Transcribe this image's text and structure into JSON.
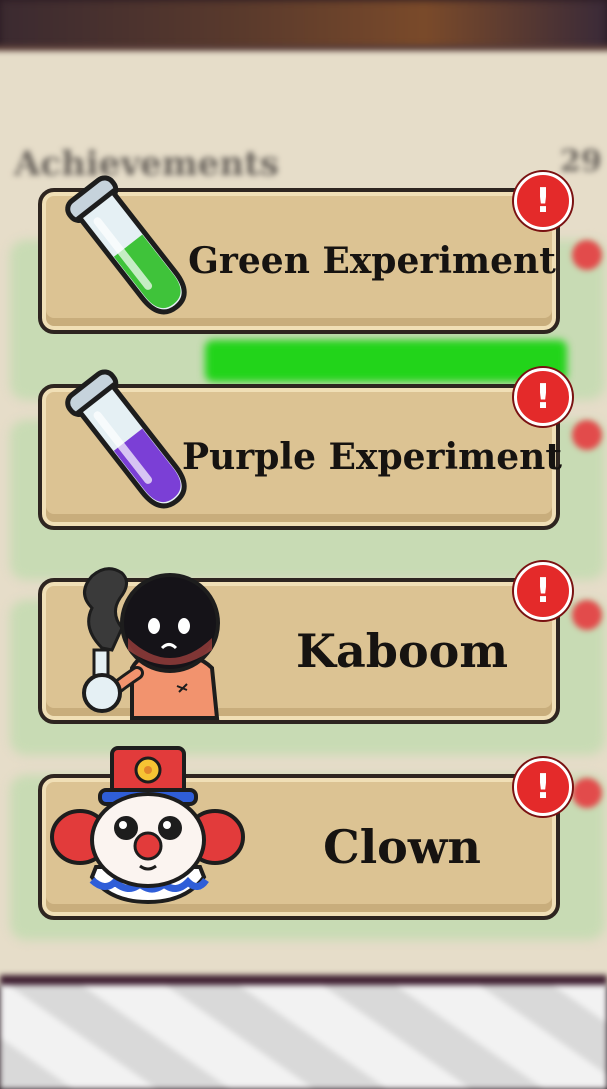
{
  "background": {
    "header_title": "Achievements",
    "header_count": "29"
  },
  "achievements": [
    {
      "title": "Green Experiment",
      "icon": "green-test-tube-icon",
      "alert": "!"
    },
    {
      "title": "Purple Experiment",
      "icon": "purple-test-tube-icon",
      "alert": "!"
    },
    {
      "title": "Kaboom",
      "icon": "exploded-character-icon",
      "alert": "!"
    },
    {
      "title": "Clown",
      "icon": "clown-face-icon",
      "alert": "!"
    }
  ],
  "colors": {
    "card_fill": "#dcc393",
    "card_border": "#2e2520",
    "alert_red": "#e42a2a",
    "green_liquid": "#3fc33a",
    "purple_liquid": "#7b3fd6"
  }
}
